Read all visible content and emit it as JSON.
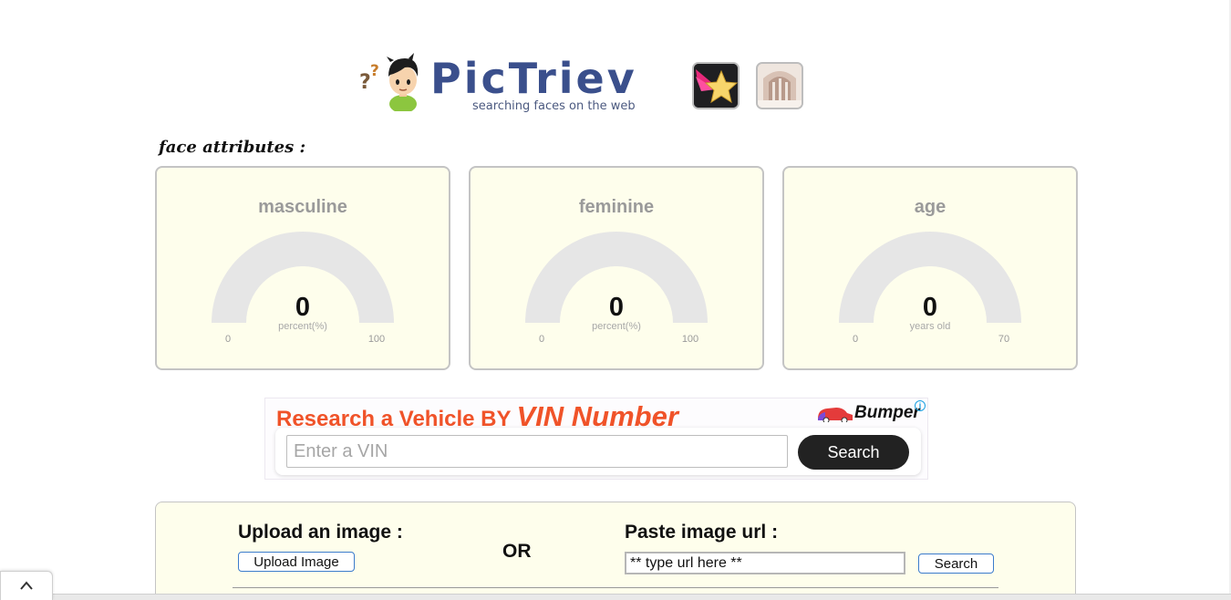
{
  "header": {
    "brand": "PicTriev",
    "tagline": "searching faces on the web",
    "logo_icon": "boy-mascot-icon",
    "app_icons": [
      "star-app-icon",
      "arch-app-icon"
    ]
  },
  "face_attributes": {
    "title": "face attributes :",
    "gauges": [
      {
        "label": "masculine",
        "value": "0",
        "unit": "percent(%)",
        "min": "0",
        "max": "100",
        "fraction": 0
      },
      {
        "label": "feminine",
        "value": "0",
        "unit": "percent(%)",
        "min": "0",
        "max": "100",
        "fraction": 0
      },
      {
        "label": "age",
        "value": "0",
        "unit": "years old",
        "min": "0",
        "max": "70",
        "fraction": 0
      }
    ]
  },
  "ad": {
    "headline": "Research a Vehicle BY",
    "headline_emphasis": "VIN Number",
    "brand": "Bumper",
    "info_icon": "i",
    "input_placeholder": "Enter a VIN",
    "button_label": "Search",
    "colors": {
      "headline": "#f05329",
      "button": "#222222"
    }
  },
  "upload": {
    "upload_title": "Upload an image :",
    "upload_button": "Upload Image",
    "or_label": "OR",
    "paste_title": "Paste image url :",
    "url_value": "** type url here **",
    "search_button": "Search"
  },
  "footer": {
    "collapse_icon": "chevron-up-icon"
  },
  "colors": {
    "card_background": "#fefeec",
    "card_border": "#c4c4c4",
    "brand_blue": "#3a4f8c",
    "gauge_track": "#e6e6e6"
  }
}
